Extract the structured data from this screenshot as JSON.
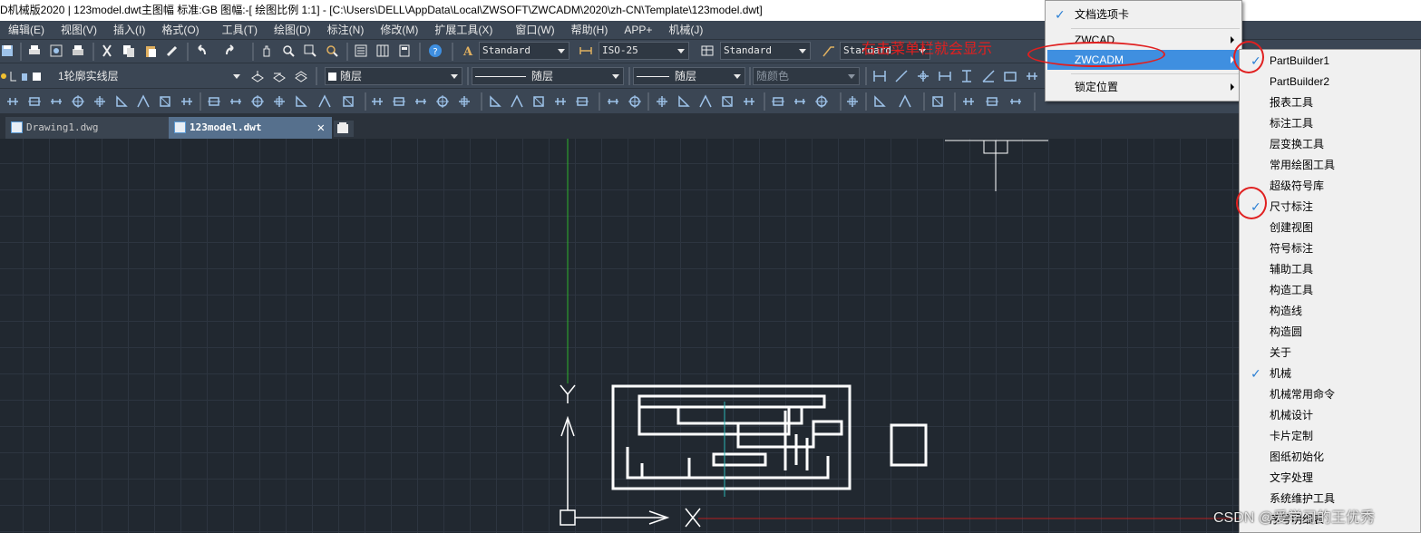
{
  "title_bar": {
    "text": "D机械版2020 | 123model.dwt主图幅  标准:GB 图幅:-[ 绘图比例 1:1] - [C:\\Users\\DELL\\AppData\\Local\\ZWSOFT\\ZWCADM\\2020\\zh-CN\\Template\\123model.dwt]"
  },
  "menubar": {
    "items": [
      "编辑(E)",
      "视图(V)",
      "插入(I)",
      "格式(O)",
      "工具(T)",
      "绘图(D)",
      "标注(N)",
      "修改(M)",
      "扩展工具(X)",
      "窗口(W)",
      "帮助(H)",
      "APP+",
      "机械(J)"
    ]
  },
  "toolbar1": {
    "text_style": "Standard",
    "dim_style": "ISO-25",
    "table_style": "Standard",
    "mleader_style": "Standard"
  },
  "toolbar2": {
    "layer": "1轮廓实线层",
    "color": "随层",
    "linetype": "随层",
    "lineweight": "随层",
    "plotstyle": "随颜色"
  },
  "tabs": [
    {
      "label": "Drawing1.dwg"
    },
    {
      "label": "123model.dwt"
    }
  ],
  "annotation": {
    "text": "右击菜单栏就会显示"
  },
  "context_menu": {
    "items": [
      {
        "label": "文档选项卡",
        "checked": true,
        "submenu": false
      },
      {
        "label": "ZWCAD",
        "checked": false,
        "submenu": true
      },
      {
        "label": "ZWCADM",
        "checked": false,
        "submenu": true,
        "selected": true
      },
      {
        "label": "锁定位置",
        "checked": false,
        "submenu": true
      }
    ]
  },
  "submenu": {
    "items": [
      {
        "label": "PartBuilder1",
        "checked": true
      },
      {
        "label": "PartBuilder2",
        "checked": false
      },
      {
        "label": "报表工具",
        "checked": false
      },
      {
        "label": "标注工具",
        "checked": false
      },
      {
        "label": "层变换工具",
        "checked": false
      },
      {
        "label": "常用绘图工具",
        "checked": false
      },
      {
        "label": "超级符号库",
        "checked": false
      },
      {
        "label": "尺寸标注",
        "checked": true
      },
      {
        "label": "创建视图",
        "checked": false
      },
      {
        "label": "符号标注",
        "checked": false
      },
      {
        "label": "辅助工具",
        "checked": false
      },
      {
        "label": "构造工具",
        "checked": false
      },
      {
        "label": "构造线",
        "checked": false
      },
      {
        "label": "构造圆",
        "checked": false
      },
      {
        "label": "关于",
        "checked": false
      },
      {
        "label": "机械",
        "checked": true
      },
      {
        "label": "机械常用命令",
        "checked": false
      },
      {
        "label": "机械设计",
        "checked": false
      },
      {
        "label": "卡片定制",
        "checked": false
      },
      {
        "label": "图纸初始化",
        "checked": false
      },
      {
        "label": "文字处理",
        "checked": false
      },
      {
        "label": "系统维护工具",
        "checked": false
      },
      {
        "label": "序号明细表",
        "checked": false
      }
    ]
  },
  "watermark": "CSDN @爱学习的王优秀",
  "colors": {
    "annotation": "#e02020",
    "menu_highlight": "#3f8fe0",
    "check": "#2a7fd4",
    "canvas_bg": "#212830"
  }
}
